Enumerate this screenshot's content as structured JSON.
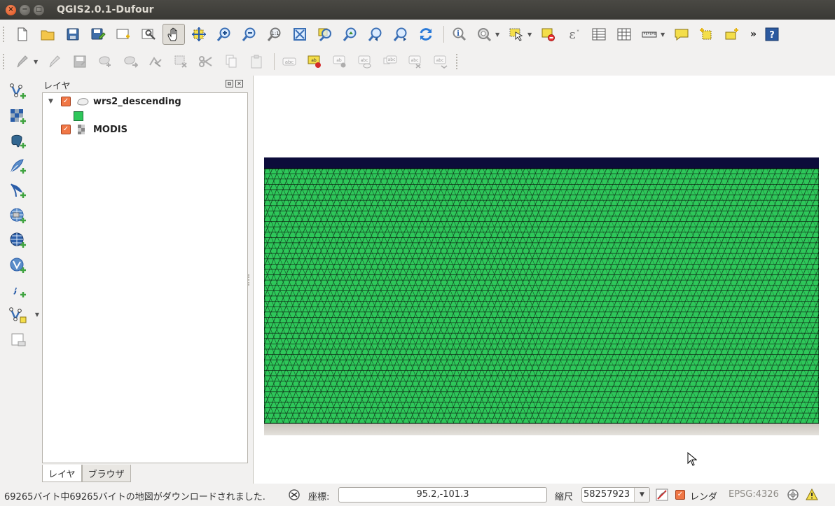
{
  "window": {
    "title": "QGIS2.0.1-Dufour",
    "close_glyph": "×",
    "minimize_glyph": "−",
    "maximize_glyph": "□"
  },
  "toolbar_main": {
    "icons": [
      "new-project-icon",
      "open-project-icon",
      "save-project-icon",
      "save-as-icon",
      "new-print-composer-icon",
      "composer-manager-icon",
      "pan-icon",
      "pan-to-selection-icon",
      "zoom-in-icon",
      "zoom-out-icon",
      "zoom-actual-size-icon",
      "zoom-full-icon",
      "zoom-to-selection-icon",
      "zoom-to-layer-icon",
      "zoom-last-icon",
      "zoom-next-icon",
      "refresh-icon",
      "identify-icon",
      "action-icon",
      "select-features-icon",
      "deselect-icon",
      "expression-icon",
      "attribute-table-icon",
      "statistics-icon",
      "measure-icon",
      "annotation-icon",
      "new-shapefile-icon",
      "add-part-icon",
      "help-icon"
    ],
    "overflow_label": "»"
  },
  "toolbar_edit": {
    "icons": [
      "toggle-editing-icon",
      "edit-pencil-icon",
      "save-edits-icon",
      "add-feature-icon",
      "move-feature-icon",
      "node-tool-icon",
      "delete-selected-icon",
      "cut-features-icon",
      "copy-features-icon",
      "paste-features-icon",
      "label-tool-icon",
      "pin-labels-icon",
      "show-hide-labels-icon",
      "move-label-icon",
      "rotate-label-icon",
      "change-label-icon"
    ]
  },
  "left_toolbar": {
    "icons": [
      "add-vector-layer-icon",
      "add-raster-layer-icon",
      "add-postgis-layer-icon",
      "add-spatialite-layer-icon",
      "add-mssql-layer-icon",
      "add-wms-layer-icon",
      "add-wcs-layer-icon",
      "add-wfs-layer-icon",
      "add-delimited-text-icon",
      "new-vector-layer-icon",
      "remove-layer-icon"
    ]
  },
  "layers_panel": {
    "title": "レイヤ",
    "layers": [
      {
        "name": "wrs2_descending",
        "checked": true,
        "expanded": true,
        "symbol_color": "#2ec75a"
      },
      {
        "name": "MODIS",
        "checked": true
      }
    ],
    "tabs": [
      "レイヤ",
      "ブラウザ"
    ],
    "active_tab": "レイヤ"
  },
  "status": {
    "message": "69265バイト中69265バイトの地図がダウンロードされました.",
    "coord_label": "座標:",
    "coord_value": "95.2,-101.3",
    "scale_label": "縮尺",
    "scale_value": "58257923",
    "render_label": "レンダ",
    "render_checked": true,
    "crs": "EPSG:4326"
  },
  "colors": {
    "grid_fill": "#2ec75a",
    "grid_line": "#0b1f10",
    "ocean_top": "#0c0c3a",
    "checkbox": "#f07746"
  }
}
